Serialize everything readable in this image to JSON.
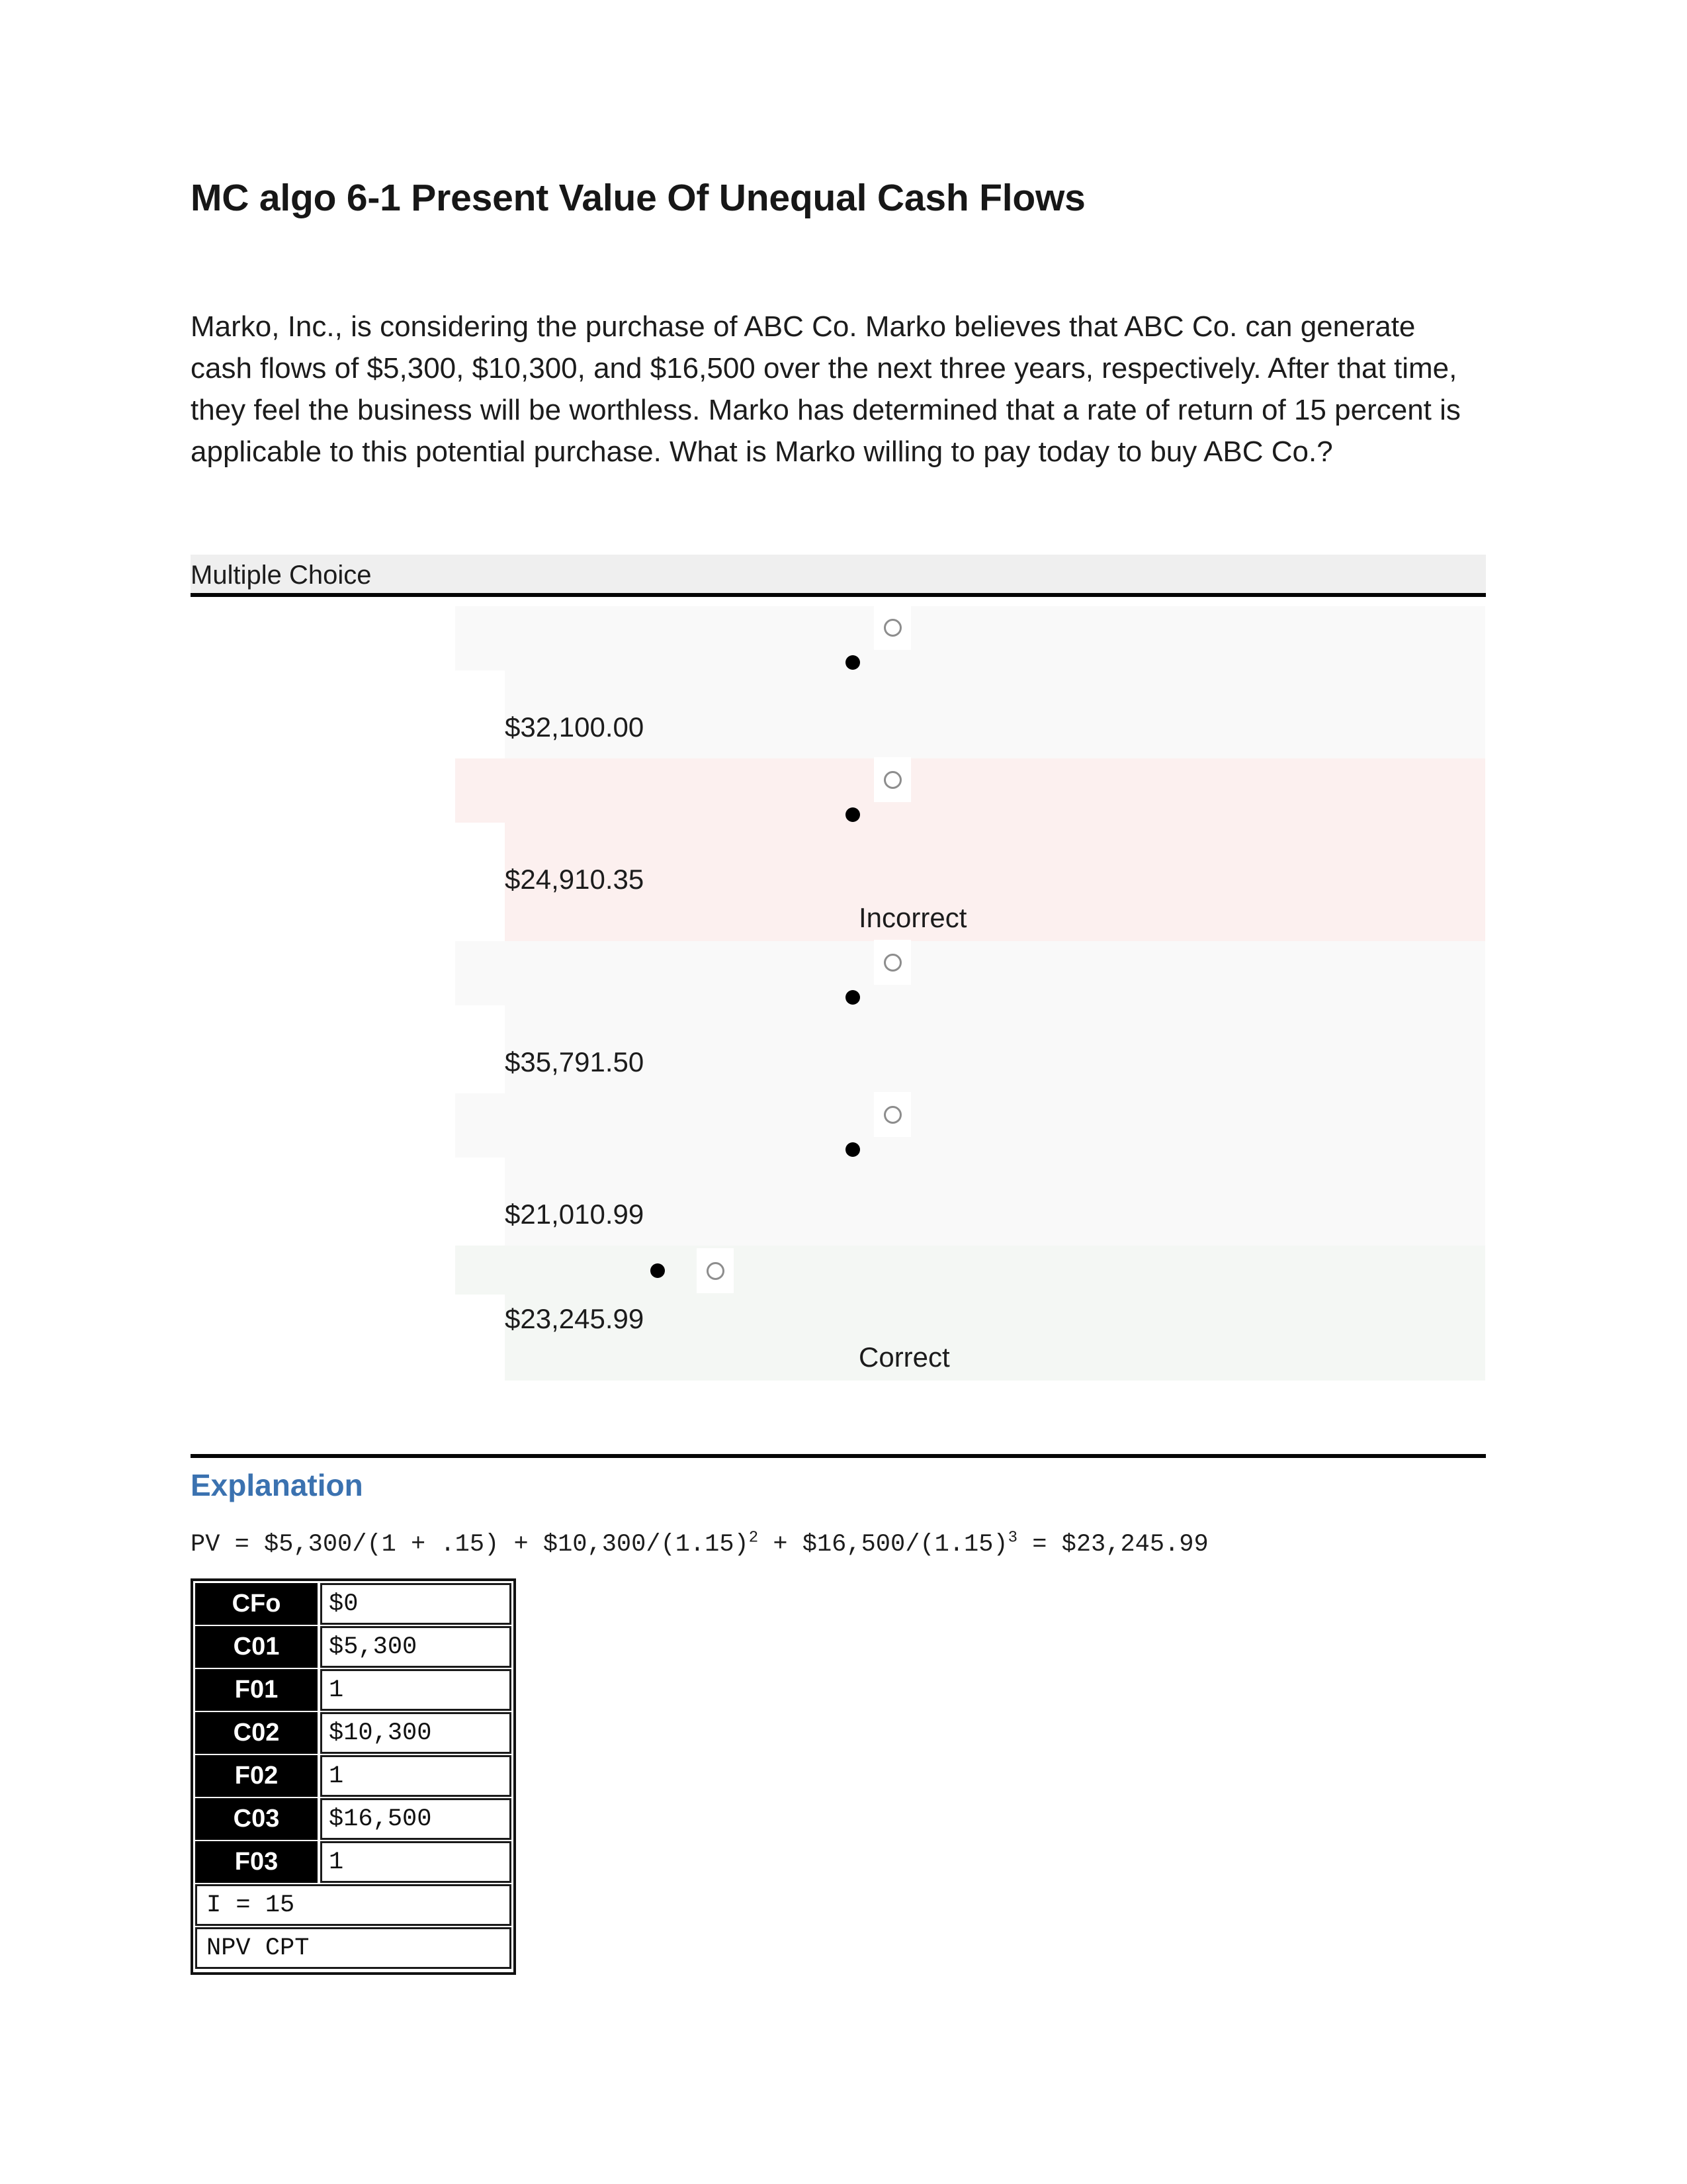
{
  "title": "MC algo 6-1 Present Value Of Unequal Cash Flows",
  "question": {
    "body": "Marko, Inc., is considering the purchase of ABC Co. Marko believes that ABC Co. can generate cash flows of $5,300, $10,300, and $16,500 over the next three years, respectively. After that time, they feel the business will be worthless. Marko has determined that a rate of return of 15 percent is applicable to this potential purchase. What is Marko willing to pay today to buy ABC Co.?",
    "type_label": "Multiple Choice"
  },
  "options": [
    {
      "value": "$32,100.00",
      "verdict": "",
      "state": "neutral"
    },
    {
      "value": "$24,910.35",
      "verdict": "Incorrect",
      "state": "incorrect"
    },
    {
      "value": "$35,791.50",
      "verdict": "",
      "state": "neutral"
    },
    {
      "value": "$21,010.99",
      "verdict": "",
      "state": "neutral"
    },
    {
      "value": "$23,245.99",
      "verdict": "Correct",
      "state": "correct"
    }
  ],
  "explanation": {
    "heading": "Explanation",
    "formula_prefix": "PV = $5,300/(1 + .15) + $10,300/(1.15)",
    "formula_exp1": "2",
    "formula_mid": " + $16,500/(1.15)",
    "formula_exp2": "3",
    "formula_suffix": " = $23,245.99"
  },
  "calculator": {
    "rows": [
      {
        "key": "CFo",
        "value": "$0"
      },
      {
        "key": "C01",
        "value": "$5,300"
      },
      {
        "key": "F01",
        "value": "1"
      },
      {
        "key": "C02",
        "value": "$10,300"
      },
      {
        "key": "F02",
        "value": "1"
      },
      {
        "key": "C03",
        "value": "$16,500"
      },
      {
        "key": "F03",
        "value": "1"
      }
    ],
    "footer_rows": [
      "I = 15",
      "NPV CPT"
    ]
  },
  "colors": {
    "incorrect_bg": "#fcf0ef",
    "correct_bg": "#f4f7f4",
    "neutral_bg": "#f9f9f9",
    "mc_bar_bg": "#efefef",
    "explanation_accent": "#3b72b0"
  }
}
